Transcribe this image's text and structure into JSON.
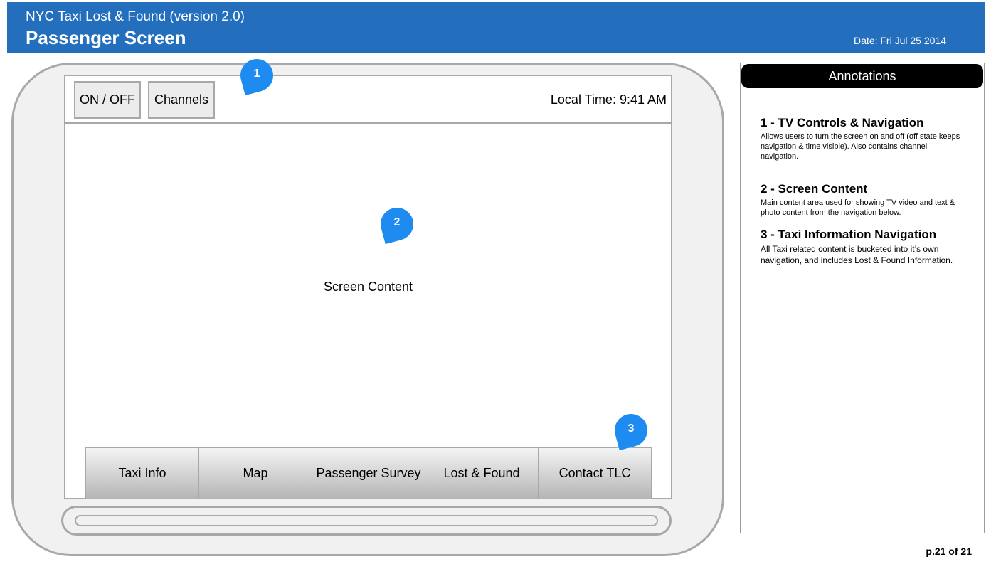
{
  "header": {
    "app_title": "NYC Taxi Lost & Found  (version 2.0)",
    "page_title": "Passenger Screen",
    "date": "Date: Fri Jul 25 2014",
    "color": "#236fbd"
  },
  "device": {
    "controls": {
      "on_off_label": "ON / OFF",
      "channels_label": "Channels",
      "local_time": "Local Time: 9:41 AM"
    },
    "screen_content_label": "Screen Content",
    "nav_tabs": [
      {
        "label": "Taxi Info"
      },
      {
        "label": "Map"
      },
      {
        "label": "Passenger Survey"
      },
      {
        "label": "Lost & Found"
      },
      {
        "label": "Contact TLC"
      }
    ]
  },
  "markers": [
    {
      "number": "1"
    },
    {
      "number": "2"
    },
    {
      "number": "3"
    }
  ],
  "annotations": {
    "title": "Annotations",
    "items": [
      {
        "heading": "1 - TV Controls & Navigation",
        "text": "Allows users to turn the screen on and off (off state keeps navigation & time visible). Also contains channel navigation."
      },
      {
        "heading": "2 - Screen Content",
        "text": "Main content area used for showing TV video and text & photo content from the navigation below."
      },
      {
        "heading": "3 - Taxi Information Navigation",
        "text": "All Taxi related content is bucketed into it’s own navigation, and includes Lost & Found Information."
      }
    ]
  },
  "page_number": "p.21 of 21",
  "colors": {
    "marker": "#1e8bf0",
    "device_border": "#a8a8a8"
  }
}
